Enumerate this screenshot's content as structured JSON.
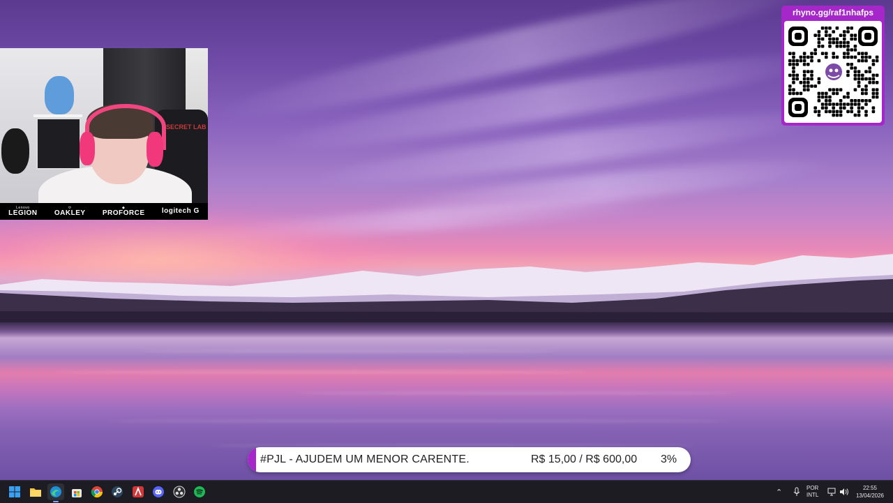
{
  "overlay": {
    "qr_url": "rhyno.gg/raf1nhafps",
    "sponsors": [
      {
        "small": "Lenovo",
        "main": "LEGION"
      },
      {
        "small": "",
        "main": "OAKLEY"
      },
      {
        "small": "",
        "main": "PROFORCE"
      },
      {
        "small": "",
        "main": "logitech G"
      }
    ],
    "chair_brand": "SECRET LAB"
  },
  "donation": {
    "message": "#PJL - AJUDEM UM MENOR CARENTE.",
    "amount": "R$ 15,00 / R$ 600,00",
    "percent": "3%",
    "progress_fraction": 0.03
  },
  "taskbar": {
    "apps": [
      {
        "name": "start",
        "icon": "windows-icon"
      },
      {
        "name": "file-explorer",
        "icon": "folder-icon"
      },
      {
        "name": "edge",
        "icon": "edge-icon",
        "active": true
      },
      {
        "name": "store",
        "icon": "store-icon"
      },
      {
        "name": "chrome",
        "icon": "chrome-icon"
      },
      {
        "name": "steam",
        "icon": "steam-icon"
      },
      {
        "name": "riot",
        "icon": "valorant-icon"
      },
      {
        "name": "discord",
        "icon": "discord-icon"
      },
      {
        "name": "obs",
        "icon": "obs-icon"
      },
      {
        "name": "spotify",
        "icon": "spotify-icon"
      }
    ],
    "tray": {
      "language_line1": "POR",
      "language_line2": "INTL",
      "time": "22:55",
      "date": "13/04/2026"
    }
  },
  "colors": {
    "accent": "#a526c9",
    "taskbar": "#1c1c22"
  }
}
